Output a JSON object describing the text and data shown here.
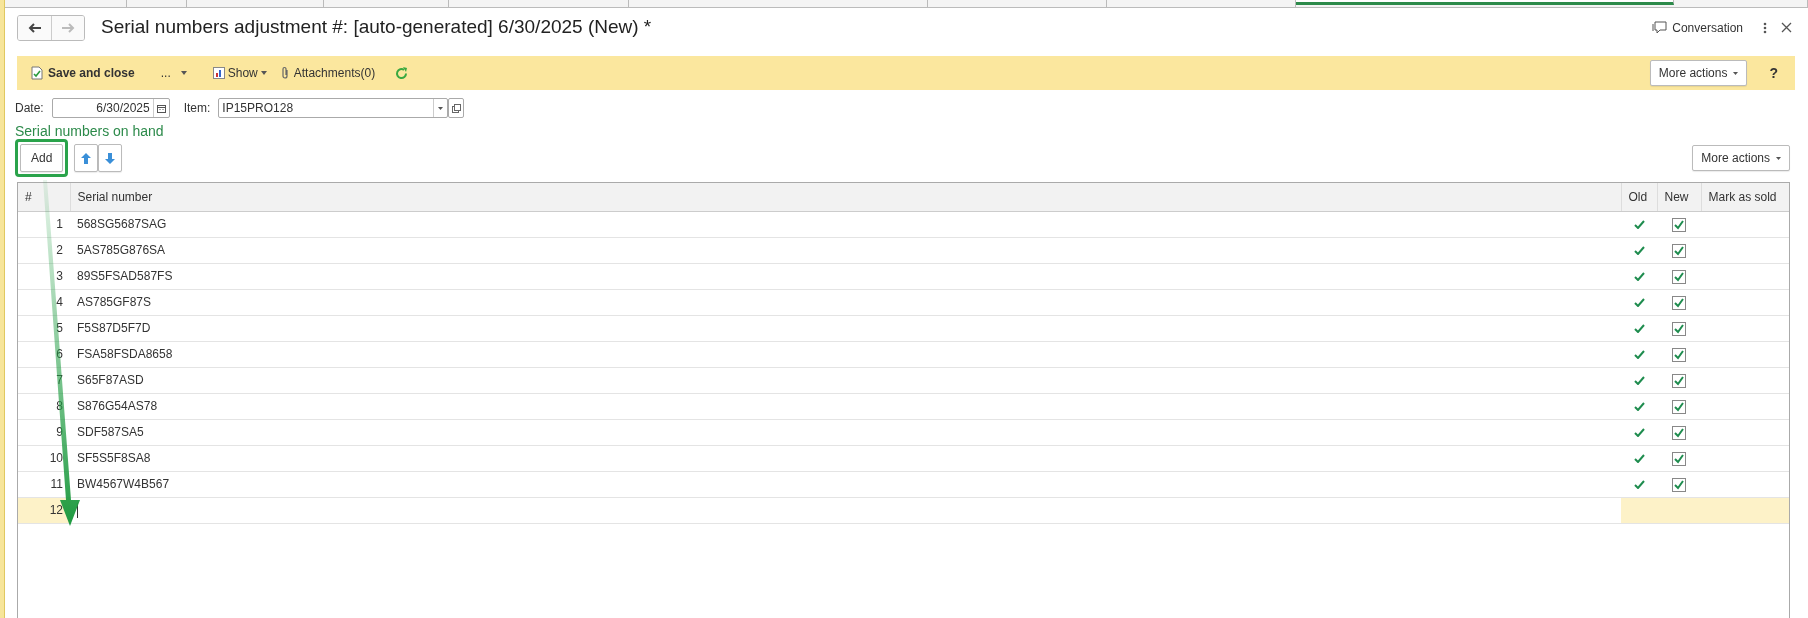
{
  "top_tabs": [
    {
      "selected": false
    },
    {
      "selected": false
    },
    {
      "selected": false
    },
    {
      "selected": false
    },
    {
      "selected": false
    },
    {
      "selected": false
    },
    {
      "selected": false
    },
    {
      "selected": false
    },
    {
      "selected": true
    },
    {
      "selected": false
    }
  ],
  "window": {
    "title": "Serial numbers adjustment #: [auto-generated] 6/30/2025 (New) *",
    "conversation": "Conversation"
  },
  "toolbar": {
    "save": "Save and close",
    "more_menu": "...",
    "show": "Show",
    "attachments": "Attachments(0)",
    "more_actions": "More actions",
    "help": "?"
  },
  "form": {
    "date_label": "Date:",
    "date": "6/30/2025",
    "item_label": "Item:",
    "item": "IP15PRO128"
  },
  "section_title": "Serial numbers on hand",
  "table_toolbar": {
    "add": "Add",
    "more_actions": "More actions"
  },
  "table": {
    "columns": [
      "#",
      "Serial number",
      "Old",
      "New",
      "Mark as sold"
    ],
    "rows": [
      {
        "num": "1",
        "serial": "568SG5687SAG",
        "old": true,
        "new": true,
        "selected": false
      },
      {
        "num": "2",
        "serial": "5AS785G876SA",
        "old": true,
        "new": true,
        "selected": false
      },
      {
        "num": "3",
        "serial": "89S5FSAD587FS",
        "old": true,
        "new": true,
        "selected": false
      },
      {
        "num": "4",
        "serial": "AS785GF87S",
        "old": true,
        "new": true,
        "selected": false
      },
      {
        "num": "5",
        "serial": "F5S87D5F7D",
        "old": true,
        "new": true,
        "selected": false
      },
      {
        "num": "6",
        "serial": "FSA58FSDA8658",
        "old": true,
        "new": true,
        "selected": false
      },
      {
        "num": "7",
        "serial": "S65F87ASD",
        "old": true,
        "new": true,
        "selected": false
      },
      {
        "num": "8",
        "serial": "S876G54AS78",
        "old": true,
        "new": true,
        "selected": false
      },
      {
        "num": "9",
        "serial": "SDF587SA5",
        "old": true,
        "new": true,
        "selected": false
      },
      {
        "num": "10",
        "serial": "SF5S5F8SA8",
        "old": true,
        "new": true,
        "selected": false
      },
      {
        "num": "11",
        "serial": "BW4567W4B567",
        "old": true,
        "new": true,
        "selected": false
      },
      {
        "num": "12",
        "old": false,
        "selected": true
      }
    ]
  }
}
